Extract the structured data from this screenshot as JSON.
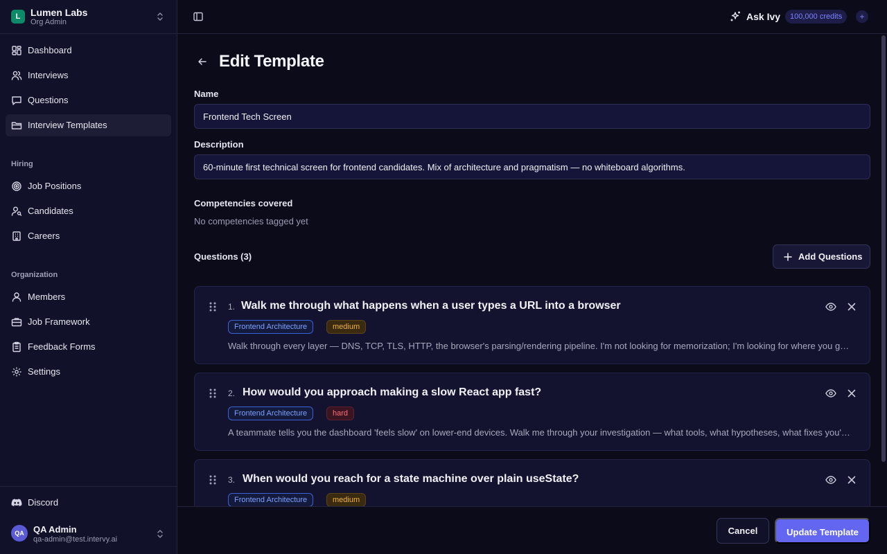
{
  "org": {
    "initial": "L",
    "name": "Lumen Labs",
    "role": "Org Admin",
    "badge_color": "#0d8a68"
  },
  "nav_main": [
    {
      "label": "Dashboard",
      "icon": "dashboard-icon"
    },
    {
      "label": "Interviews",
      "icon": "users-icon"
    },
    {
      "label": "Questions",
      "icon": "chat-icon"
    },
    {
      "label": "Interview Templates",
      "icon": "folder-icon",
      "active": true
    }
  ],
  "hiring": {
    "title": "Hiring",
    "items": [
      {
        "label": "Job Positions",
        "icon": "target-icon"
      },
      {
        "label": "Candidates",
        "icon": "user-search-icon"
      },
      {
        "label": "Careers",
        "icon": "building-icon"
      }
    ]
  },
  "organization": {
    "title": "Organization",
    "items": [
      {
        "label": "Members",
        "icon": "user-icon"
      },
      {
        "label": "Job Framework",
        "icon": "briefcase-icon"
      },
      {
        "label": "Feedback Forms",
        "icon": "clipboard-icon"
      },
      {
        "label": "Settings",
        "icon": "gear-icon"
      }
    ]
  },
  "discord": {
    "label": "Discord",
    "icon": "discord-icon"
  },
  "user": {
    "initials": "QA",
    "name": "QA Admin",
    "email": "qa-admin@test.intervy.ai"
  },
  "topbar": {
    "ask_label": "Ask Ivy",
    "credits": "100,000 credits",
    "plus": "+"
  },
  "page": {
    "title": "Edit Template",
    "name_label": "Name",
    "name_value": "Frontend Tech Screen",
    "description_label": "Description",
    "description_value": "60-minute first technical screen for frontend candidates. Mix of architecture and pragmatism — no whiteboard algorithms.",
    "competencies_label": "Competencies covered",
    "competencies_empty": "No competencies tagged yet",
    "questions_label": "Questions (3)",
    "add_questions_label": "Add Questions"
  },
  "questions": [
    {
      "number": "1.",
      "title": "Walk me through what happens when a user types a URL into a browser",
      "competency": "Frontend Architecture",
      "difficulty": "medium",
      "description": "Walk through every layer — DNS, TCP, TLS, HTTP, the browser's parsing/rendering pipeline. I'm not looking for memorization; I'm looking for where you go deep and what you know matters."
    },
    {
      "number": "2.",
      "title": "How would you approach making a slow React app fast?",
      "competency": "Frontend Architecture",
      "difficulty": "hard",
      "description": "A teammate tells you the dashboard 'feels slow' on lower-end devices. Walk me through your investigation — what tools, what hypotheses, what fixes you'd try first."
    },
    {
      "number": "3.",
      "title": "When would you reach for a state machine over plain useState?",
      "competency": "Frontend Architecture",
      "difficulty": "medium",
      "description": ""
    }
  ],
  "footer": {
    "cancel_label": "Cancel",
    "submit_label": "Update Template"
  },
  "colors": {
    "primary": "#6366f1",
    "medium": "#f0b03c",
    "hard": "#ff6b7a",
    "competency": "#7ea0ff"
  }
}
